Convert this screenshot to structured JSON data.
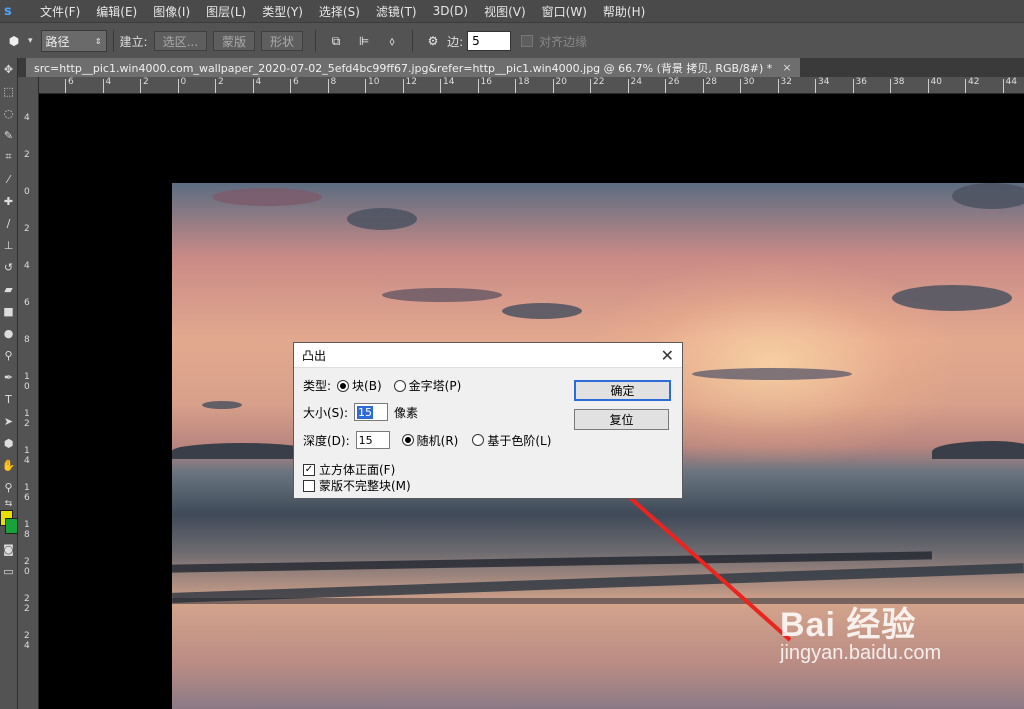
{
  "app_logo": "s",
  "menu": [
    "文件(F)",
    "编辑(E)",
    "图像(I)",
    "图层(L)",
    "类型(Y)",
    "选择(S)",
    "滤镜(T)",
    "3D(D)",
    "视图(V)",
    "窗口(W)",
    "帮助(H)"
  ],
  "options": {
    "path_mode": "路径",
    "make_label": "建立:",
    "selection_btn": "选区...",
    "mask_btn": "蒙版",
    "shape_btn": "形状",
    "sides_label": "边:",
    "sides_value": "5",
    "align_edges": "对齐边缘"
  },
  "document_tab": {
    "title": "src=http__pic1.win4000.com_wallpaper_2020-07-02_5efd4bc99ff67.jpg&refer=http__pic1.win4000.jpg @ 66.7% (背景 拷贝, RGB/8#) *",
    "close": "×"
  },
  "hruler_ticks": [
    "6",
    "4",
    "2",
    "0",
    "2",
    "4",
    "6",
    "8",
    "10",
    "12",
    "14",
    "16",
    "18",
    "20",
    "22",
    "24",
    "26",
    "28",
    "30",
    "32",
    "34",
    "36",
    "38",
    "40",
    "42",
    "44"
  ],
  "vruler_ticks": [
    "4",
    "2",
    "0",
    "2",
    "4",
    "6",
    "8",
    "1 0",
    "1 2",
    "1 4",
    "1 6",
    "1 8",
    "2 0",
    "2 2",
    "2 4"
  ],
  "dialog": {
    "title": "凸出",
    "close": "✕",
    "type_label": "类型:",
    "type_block": "块(B)",
    "type_pyramid": "金字塔(P)",
    "size_label": "大小(S):",
    "size_value": "15",
    "size_unit": "像素",
    "depth_label": "深度(D):",
    "depth_value": "15",
    "depth_random": "随机(R)",
    "depth_level": "基于色阶(L)",
    "solid_front": "立方体正面(F)",
    "mask_incomplete": "蒙版不完整块(M)",
    "ok": "确定",
    "reset": "复位"
  },
  "watermark": {
    "logo": "Bai 经验",
    "url": "jingyan.baidu.com"
  }
}
